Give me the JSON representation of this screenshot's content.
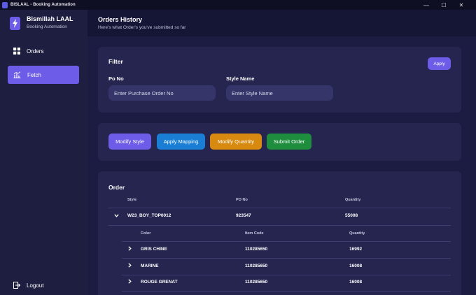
{
  "window": {
    "title": "BISLAAL - Booking Automation",
    "controls": {
      "minimize": "—",
      "maximize": "☐",
      "close": "✕"
    }
  },
  "brand": {
    "name": "Bismillah LAAL",
    "subtitle": "Booking Automation"
  },
  "sidebar": {
    "items": [
      {
        "label": "Orders",
        "icon": "grid-icon",
        "active": false
      },
      {
        "label": "Fetch",
        "icon": "chart-icon",
        "active": true
      }
    ],
    "logout": {
      "label": "Logout",
      "icon": "logout-icon"
    }
  },
  "header": {
    "title": "Orders History",
    "subtitle": "Here's what Order's you've submitted so far"
  },
  "filter": {
    "title": "Filter",
    "apply_label": "Apply",
    "po": {
      "label": "Po No",
      "placeholder": "Enter Purchase Order No"
    },
    "style": {
      "label": "Style Name",
      "placeholder": "Enter Style Name"
    }
  },
  "actions": [
    {
      "label": "Modify Style",
      "color": "#6c5ce7"
    },
    {
      "label": "Apply Mapping",
      "color": "#1a7fd4"
    },
    {
      "label": "Modify Quantity",
      "color": "#d88a10"
    },
    {
      "label": "Submit Order",
      "color": "#1e8e3e"
    }
  ],
  "order": {
    "title": "Order",
    "columns": [
      "Style",
      "PO No",
      "Quantity"
    ],
    "rows": [
      {
        "style": "W23_BOY_TOP0012",
        "po": "923547",
        "quantity": "55008",
        "expanded": true,
        "sub_columns": [
          "Color",
          "Item Code",
          "Quantity"
        ],
        "items": [
          {
            "color": "GRIS CHINE",
            "item_code": "110285650",
            "quantity": "16992"
          },
          {
            "color": "MARINE",
            "item_code": "110285650",
            "quantity": "16008"
          },
          {
            "color": "ROUGE GRENAT",
            "item_code": "110285650",
            "quantity": "16008"
          }
        ]
      }
    ]
  }
}
